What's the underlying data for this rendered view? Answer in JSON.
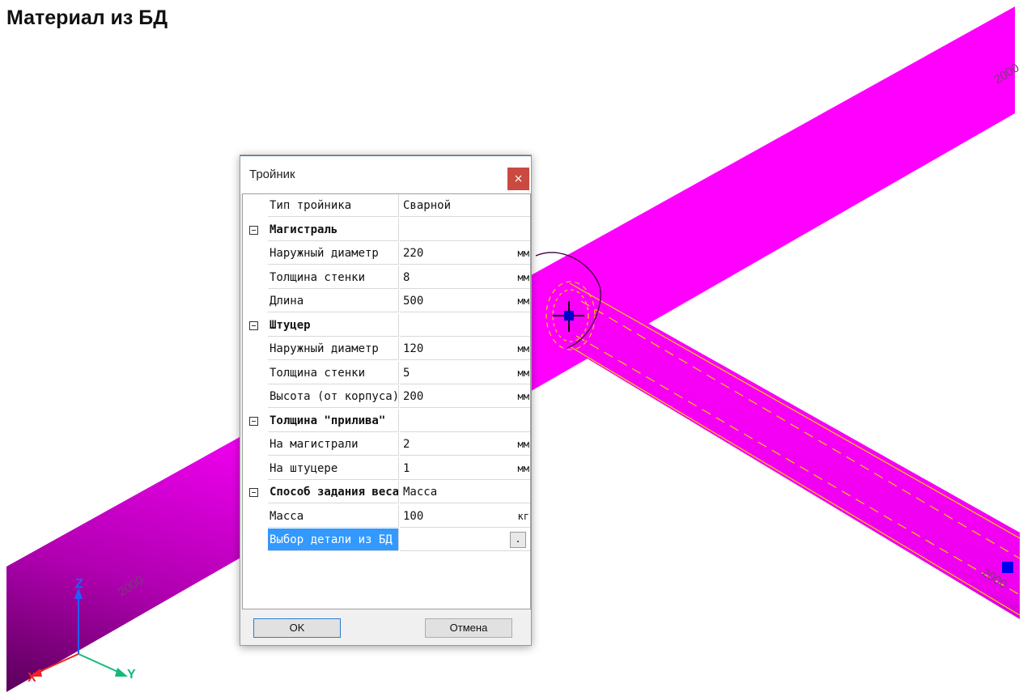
{
  "page": {
    "heading": "Материал из БД"
  },
  "viewport": {
    "dimension_labels": [
      "2000",
      "2000",
      "2000"
    ],
    "axes": {
      "x": "X",
      "y": "Y",
      "z": "Z"
    },
    "colors": {
      "pipe": "#ff00ff",
      "pipe_shade": "#7a007a",
      "branch_lines": "#ffcc00",
      "marker": "#0000cc"
    }
  },
  "dialog": {
    "title": "Тройник",
    "close_label": "×",
    "rows": [
      {
        "type": "prop",
        "name": "Тип тройника",
        "value": "Сварной",
        "unit": ""
      },
      {
        "type": "group",
        "name": "Магистраль",
        "value": "",
        "unit": ""
      },
      {
        "type": "prop",
        "name": "Наружный диаметр",
        "value": "220",
        "unit": "мм"
      },
      {
        "type": "prop",
        "name": "Толщина стенки",
        "value": "8",
        "unit": "мм"
      },
      {
        "type": "prop",
        "name": "Длина",
        "value": "500",
        "unit": "мм"
      },
      {
        "type": "group",
        "name": "Штуцер",
        "value": "",
        "unit": ""
      },
      {
        "type": "prop",
        "name": "Наружный диаметр",
        "value": "120",
        "unit": "мм"
      },
      {
        "type": "prop",
        "name": "Толщина стенки",
        "value": "5",
        "unit": "мм"
      },
      {
        "type": "prop",
        "name": "Высота (от корпуса)",
        "value": "200",
        "unit": "мм"
      },
      {
        "type": "group",
        "name": "Толщина \"прилива\"",
        "value": "",
        "unit": ""
      },
      {
        "type": "prop",
        "name": "На магистрали",
        "value": "2",
        "unit": "мм"
      },
      {
        "type": "prop",
        "name": "На штуцере",
        "value": "1",
        "unit": "мм"
      },
      {
        "type": "group",
        "name": "Способ задания веса",
        "value": "Масса",
        "unit": ""
      },
      {
        "type": "prop",
        "name": "Масса",
        "value": "100",
        "unit": "кг"
      },
      {
        "type": "prop",
        "name": "Выбор детали из БД",
        "value": "",
        "unit": "",
        "selected": true,
        "browse": "."
      }
    ],
    "buttons": {
      "ok": "OK",
      "cancel": "Отмена"
    }
  }
}
